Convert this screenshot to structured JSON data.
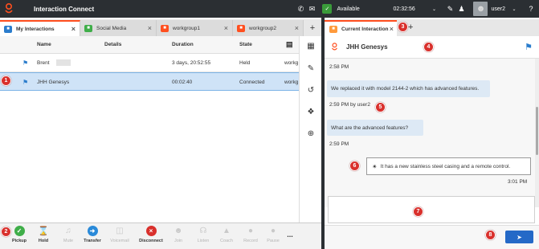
{
  "topbar": {
    "app_name": "Interaction Connect",
    "status": "Available",
    "time": "02:32:56",
    "user": "user2",
    "help": "?"
  },
  "tabs": [
    {
      "label": "My Interactions",
      "color": "#2a7ccc"
    },
    {
      "label": "Social Media",
      "color": "#3fae49"
    },
    {
      "label": "workgroup1",
      "color": "#ff4f1f"
    },
    {
      "label": "workgroup2",
      "color": "#ff4f1f"
    }
  ],
  "table": {
    "headers": [
      "Name",
      "Details",
      "Duration",
      "State",
      ""
    ],
    "rows": [
      {
        "name": "Brent",
        "details": "",
        "duration": "3 days, 20:52:55",
        "state": "Held",
        "extra": "workg"
      },
      {
        "name": "JHH Genesys",
        "details": "",
        "duration": "00:02:40",
        "state": "Connected",
        "extra": "workg"
      }
    ]
  },
  "toolbar": {
    "pickup": "Pickup",
    "hold": "Hold",
    "mute": "Mute",
    "transfer": "Transfer",
    "voicemail": "Voicemail",
    "disconnect": "Disconnect",
    "join": "Join",
    "listen": "Listen",
    "coach": "Coach",
    "record": "Record",
    "pause": "Pause",
    "more": "..."
  },
  "right": {
    "tab_label": "Current Interaction",
    "contact": "JHH Genesys",
    "messages": [
      {
        "time": "2:58 PM"
      },
      {
        "text": "We replaced it with model 2144-2 which has advanced features."
      },
      {
        "time": "2:59 PM by user2"
      },
      {
        "text": "What are the advanced features?"
      },
      {
        "time": "2:59 PM"
      },
      {
        "agent_text": "It has a new stainless steel casing and a remote control.",
        "agent_time": "3:01 PM"
      }
    ]
  },
  "callouts": [
    "1",
    "2",
    "3",
    "4",
    "5",
    "6",
    "7",
    "8"
  ],
  "colors": {
    "accent": "#ff4f1f",
    "callout": "#d9302c",
    "selected": "#cfe3f7",
    "send": "#2469c7"
  }
}
